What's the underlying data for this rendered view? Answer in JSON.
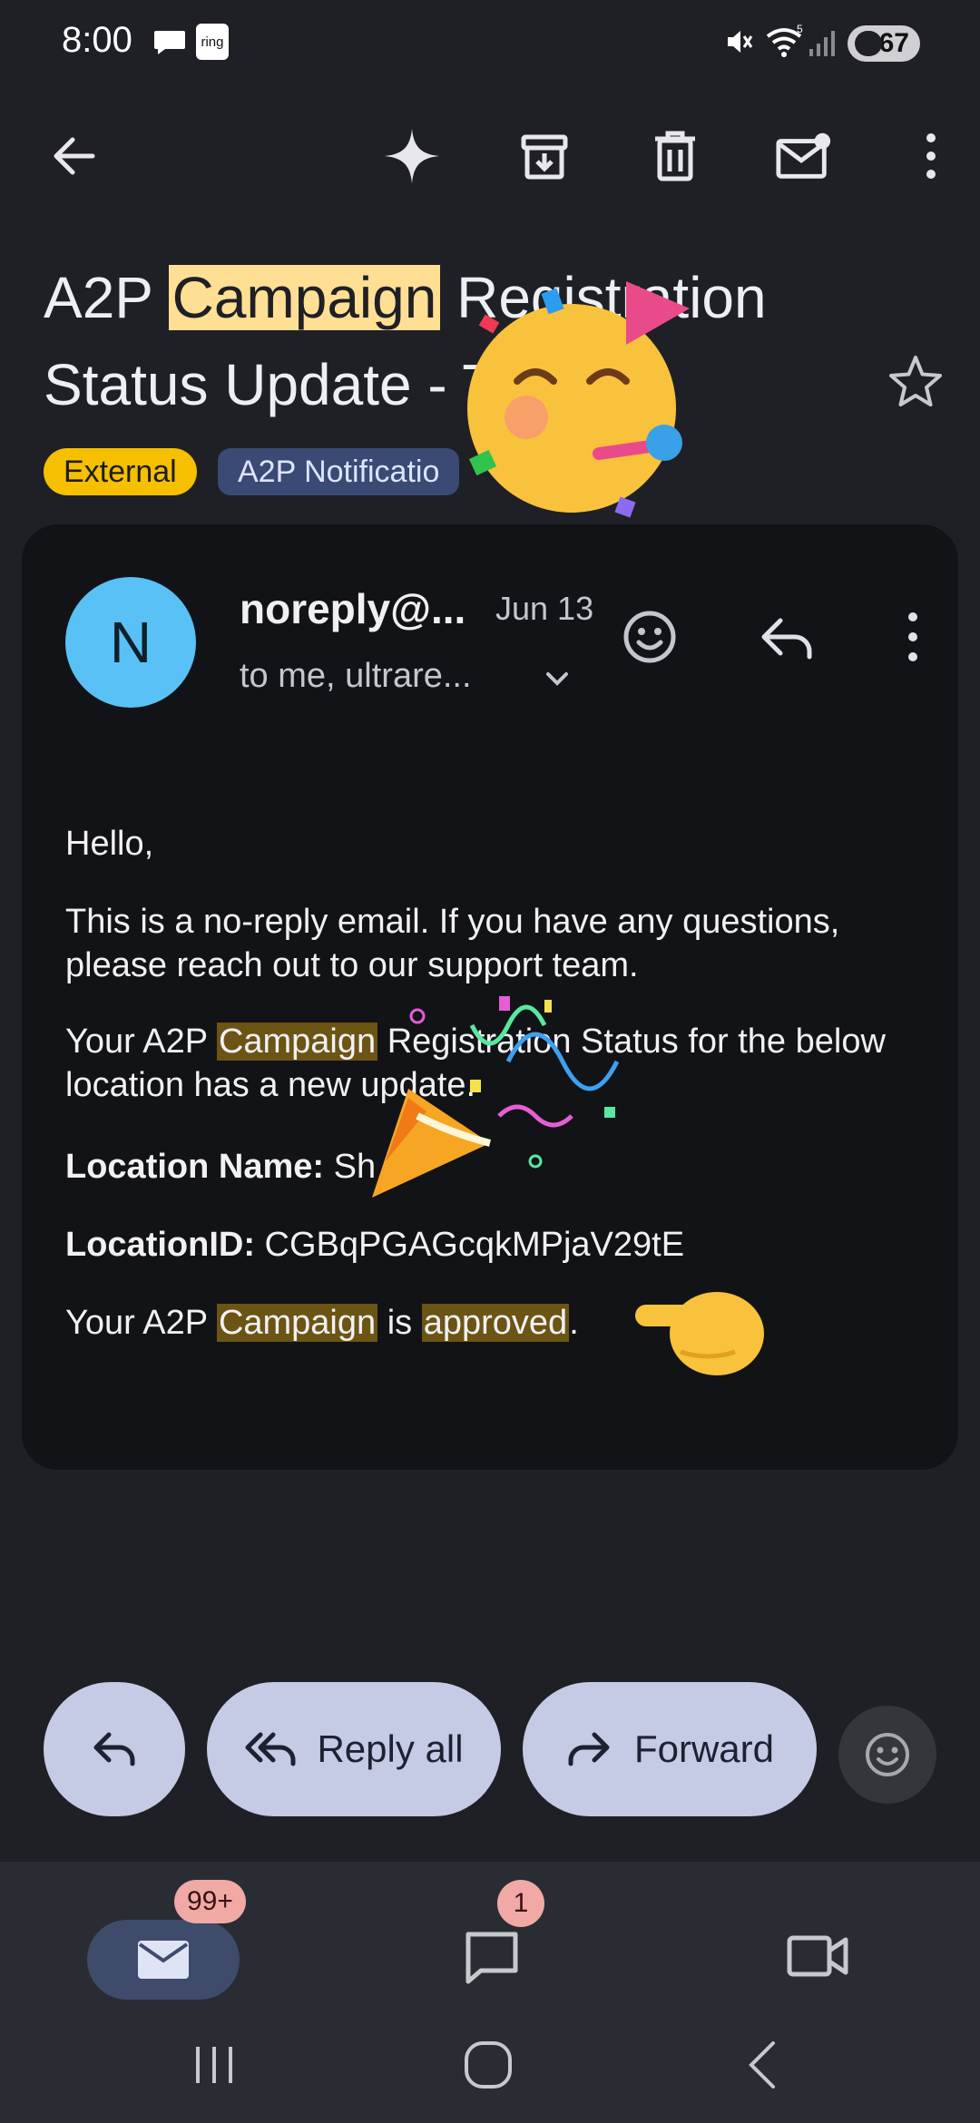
{
  "status_bar": {
    "time": "8:00",
    "ring_label": "ring",
    "battery": "67",
    "wifi_label": "5"
  },
  "email": {
    "subject_parts": [
      "A2P ",
      "Campaign",
      " Registration Status Update - ",
      "T"
    ],
    "chips": [
      "External",
      "A2P Notificatio"
    ],
    "sender_avatar_letter": "N",
    "sender": "noreply@...",
    "date": "Jun 13",
    "to_line": "to me, ultrare...",
    "greeting": "Hello,",
    "para1": "This is a no-reply email. If you have any questions, please reach out to our support team.",
    "para2_a": "Your A2P ",
    "para2_hl": "Campaign",
    "para2_b": " Registration Status for the below location has a new update.",
    "location_label": "Location Name:",
    "location_value": "Sh",
    "locationid_label": "LocationID:",
    "locationid_value": "CGBqPGAGcqkMPjaV29tE",
    "para_last_a": "Your A2P ",
    "para_last_hl1": "Campaign",
    "para_last_b": " is ",
    "para_last_hl2": "approved",
    "para_last_c": "."
  },
  "actions": {
    "reply_all": "Reply all",
    "forward": "Forward"
  },
  "nav": {
    "mail_badge": "99+",
    "chat_badge": "1"
  },
  "colors": {
    "background": "#1f2025",
    "card": "#121317",
    "accent_pill": "#c5cbe4",
    "external_chip": "#f6c000",
    "highlight_body": "#6b5414",
    "highlight_title": "#ffdf94",
    "avatar": "#59c1f6"
  }
}
